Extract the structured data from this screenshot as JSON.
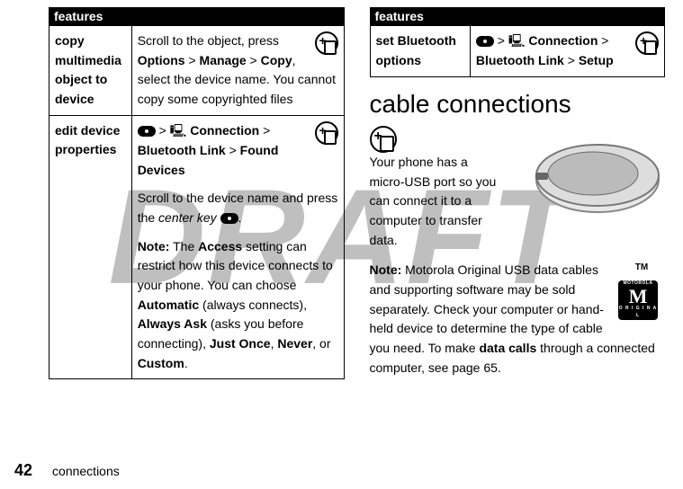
{
  "footer": {
    "page_number": "42",
    "section": "connections"
  },
  "draft_watermark": "DRAFT",
  "col_left": {
    "header": "features",
    "rows": [
      {
        "name": "copy multimedia object to device",
        "desc": {
          "line1": "Scroll to the object, press ",
          "opt": "Options",
          "gt1": " > ",
          "manage": "Manage",
          "gt2": " > ",
          "copy": "Copy",
          "line2": ", select the device name. You cannot copy some copyrighted files"
        }
      },
      {
        "name": "edit device properties",
        "desc": {
          "nav_gt1": " > ",
          "conn_label": "Connection",
          "nav_gt2": " > ",
          "bt": "Bluetooth Link",
          "nav_gt3": " > ",
          "found": "Found Devices",
          "scroll1": "Scroll to the device name and press the ",
          "ck_label": "center key",
          "period": ".",
          "note_label": "Note:",
          "note_t1": " The ",
          "access": "Access",
          "note_t2": " setting can restrict how this device connects to your phone. You can choose ",
          "auto": "Automatic",
          "auto_t": " (always connects), ",
          "ask": "Always Ask",
          "ask_t": " (asks you before connecting), ",
          "once": "Just Once",
          "comma": ", ",
          "never": "Never",
          "or": ", or ",
          "custom": "Custom",
          "end": "."
        }
      }
    ]
  },
  "col_right": {
    "header": "features",
    "row": {
      "name": "set Bluetooth options",
      "desc": {
        "nav_gt1": " > ",
        "conn_label": "Connection",
        "nav_gt2": " > ",
        "bt": "Bluetooth Link",
        "nav_gt3": " > ",
        "setup": "Setup"
      }
    },
    "cable_heading": "cable connections",
    "intro": "Your phone has a micro-USB port so you can connect it to a computer to transfer data.",
    "note_label": "Note:",
    "note_body": " Motorola Original USB data cables and supporting software may be sold separately. Check your computer or hand-held device to determine the type of cable you need. To make ",
    "data_calls": "data calls",
    "note_tail": " through a connected computer, see page 65.",
    "tm": "TM",
    "badge": {
      "top": "MOTOROLA",
      "mid": "M",
      "bottom": "O R I G I N A L"
    }
  }
}
